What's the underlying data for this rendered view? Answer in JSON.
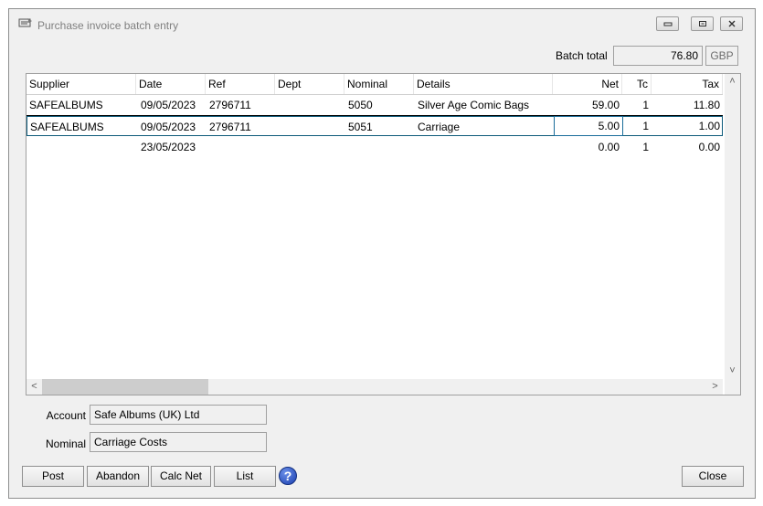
{
  "window": {
    "title": "Purchase invoice batch entry",
    "icons": [
      "minimize-icon",
      "restore-icon",
      "close-icon"
    ]
  },
  "batch": {
    "label": "Batch total",
    "value": "76.80",
    "currency": "GBP"
  },
  "grid": {
    "columns": [
      "Supplier",
      "Date",
      "Ref",
      "Dept",
      "Nominal",
      "Details",
      "Net",
      "Tc",
      "Tax"
    ],
    "rows": [
      {
        "supplier": "SAFEALBUMS",
        "date": "09/05/2023",
        "ref": "2796711",
        "dept": "",
        "nominal": "5050",
        "details": "Silver Age Comic Bags",
        "net": "59.00",
        "tc": "1",
        "tax": "11.80"
      },
      {
        "supplier": "SAFEALBUMS",
        "date": "09/05/2023",
        "ref": "2796711",
        "dept": "",
        "nominal": "5051",
        "details": "Carriage",
        "net": "5.00",
        "tc": "1",
        "tax": "1.00"
      },
      {
        "supplier": "",
        "date": "23/05/2023",
        "ref": "",
        "dept": "",
        "nominal": "",
        "details": "",
        "net": "0.00",
        "tc": "1",
        "tax": "0.00"
      }
    ]
  },
  "fields": {
    "account_label": "Account",
    "account_value": "Safe Albums (UK) Ltd",
    "nominal_label": "Nominal",
    "nominal_value": "Carriage Costs"
  },
  "buttons": {
    "post": "Post",
    "abandon": "Abandon",
    "calc_net": "Calc Net",
    "list": "List",
    "close": "Close",
    "help_icon": "help-icon"
  }
}
